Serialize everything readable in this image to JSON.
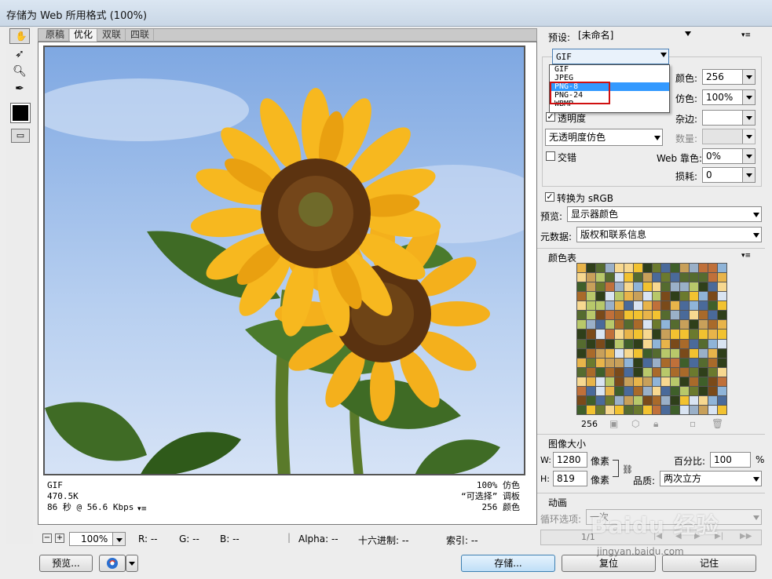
{
  "window": {
    "title": "存储为 Web 所用格式 (100%)"
  },
  "tools": [
    "hand-tool",
    "slice-select-tool",
    "zoom-tool",
    "eyedropper-tool"
  ],
  "tabs": [
    {
      "label": "原稿"
    },
    {
      "label": "优化"
    },
    {
      "label": "双联"
    },
    {
      "label": "四联"
    }
  ],
  "image_info": {
    "format": "GIF",
    "size": "470.5K",
    "time": "86 秒 @ 56.6 Kbps",
    "dither": "100% 仿色",
    "palette": "“可选择” 调板",
    "colors": "256 颜色"
  },
  "bottom_bar": {
    "zoom": "100%",
    "r": "R: --",
    "g": "G: --",
    "b": "B: --",
    "alpha": "Alpha: --",
    "hex": "十六进制: --",
    "index": "索引: --"
  },
  "buttons": {
    "preview": "预览...",
    "save": "存储...",
    "reset": "复位",
    "remember": "记住"
  },
  "settings": {
    "preset_label": "预设:",
    "preset_value": "[未命名]",
    "format_value": "GIF",
    "format_options": [
      "GIF",
      "JPEG",
      "PNG-8",
      "PNG-24",
      "WBMP"
    ],
    "highlighted_option": "PNG-8",
    "colors_label": "颜色:",
    "colors_value": "256",
    "dither_label": "仿色:",
    "dither_value": "100%",
    "transparency_label": "透明度",
    "transparency_checked": true,
    "matte_label": "杂边:",
    "no_trans_dither": "无透明度仿色",
    "amount_label": "数量:",
    "interlace_label": "交错",
    "web_snap_label": "Web 靠色:",
    "web_snap_value": "0%",
    "lossy_label": "损耗:",
    "lossy_value": "0",
    "convert_srgb": "转换为 sRGB",
    "preview_label": "预览:",
    "preview_value": "显示器颜色",
    "metadata_label": "元数据:",
    "metadata_value": "版权和联系信息"
  },
  "color_table": {
    "title": "颜色表",
    "count": "256"
  },
  "image_size": {
    "title": "图像大小",
    "w_label": "W:",
    "w_value": "1280",
    "h_label": "H:",
    "h_value": "819",
    "unit": "像素",
    "percent_label": "百分比:",
    "percent_value": "100",
    "percent_unit": "%",
    "quality_label": "品质:",
    "quality_value": "两次立方"
  },
  "animation": {
    "title": "动画",
    "loop_label": "循环选项:",
    "loop_value": "一次",
    "frame": "1/1"
  },
  "watermark": {
    "main": "Baidu 经验",
    "sub": "jingyan.baidu.com"
  }
}
